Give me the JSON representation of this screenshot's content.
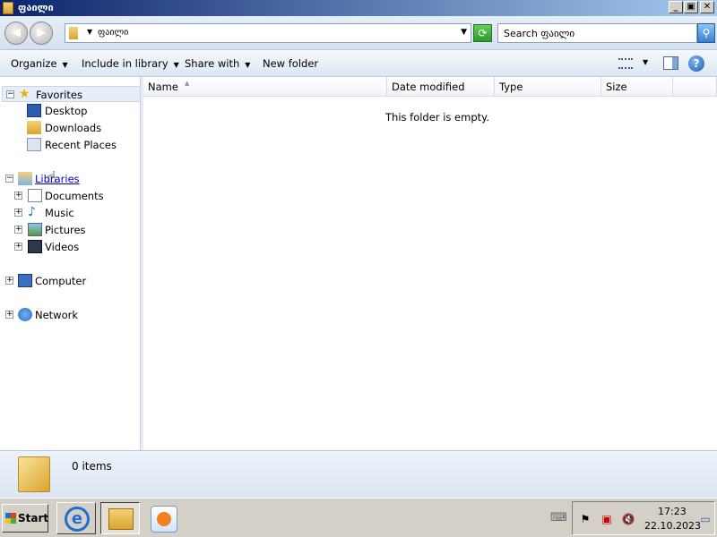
{
  "window": {
    "title": "ფაილი",
    "minimize": "_",
    "maximize": "▣",
    "close": "✕"
  },
  "address": {
    "path": "ფაილი",
    "search_placeholder": "Search ფაილი"
  },
  "toolbar": {
    "organize": "Organize",
    "include_in_library": "Include in library",
    "share_with": "Share with",
    "new_folder": "New folder",
    "help": "?"
  },
  "nav": {
    "favorites": {
      "label": "Favorites",
      "items": [
        "Desktop",
        "Downloads",
        "Recent Places"
      ]
    },
    "libraries": {
      "label": "Libraries",
      "items": [
        "Documents",
        "Music",
        "Pictures",
        "Videos"
      ]
    },
    "computer": "Computer",
    "network": "Network"
  },
  "columns": {
    "name": "Name",
    "date_modified": "Date modified",
    "type": "Type",
    "size": "Size"
  },
  "content": {
    "empty_message": "This folder is empty."
  },
  "details": {
    "item_count": "0 items"
  },
  "taskbar": {
    "start": "Start",
    "time": "17:23",
    "date": "22.10.2023"
  }
}
